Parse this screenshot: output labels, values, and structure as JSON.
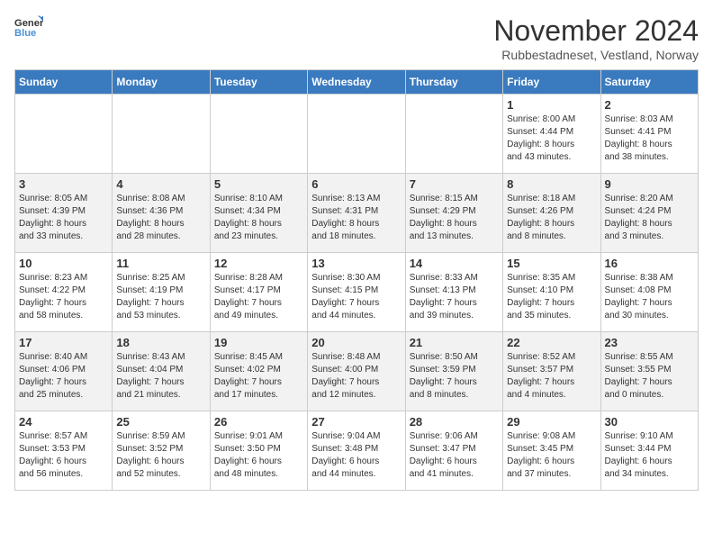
{
  "header": {
    "logo_general": "General",
    "logo_blue": "Blue",
    "month_title": "November 2024",
    "location": "Rubbestadneset, Vestland, Norway"
  },
  "weekdays": [
    "Sunday",
    "Monday",
    "Tuesday",
    "Wednesday",
    "Thursday",
    "Friday",
    "Saturday"
  ],
  "weeks": [
    [
      {
        "day": "",
        "info": ""
      },
      {
        "day": "",
        "info": ""
      },
      {
        "day": "",
        "info": ""
      },
      {
        "day": "",
        "info": ""
      },
      {
        "day": "",
        "info": ""
      },
      {
        "day": "1",
        "info": "Sunrise: 8:00 AM\nSunset: 4:44 PM\nDaylight: 8 hours\nand 43 minutes."
      },
      {
        "day": "2",
        "info": "Sunrise: 8:03 AM\nSunset: 4:41 PM\nDaylight: 8 hours\nand 38 minutes."
      }
    ],
    [
      {
        "day": "3",
        "info": "Sunrise: 8:05 AM\nSunset: 4:39 PM\nDaylight: 8 hours\nand 33 minutes."
      },
      {
        "day": "4",
        "info": "Sunrise: 8:08 AM\nSunset: 4:36 PM\nDaylight: 8 hours\nand 28 minutes."
      },
      {
        "day": "5",
        "info": "Sunrise: 8:10 AM\nSunset: 4:34 PM\nDaylight: 8 hours\nand 23 minutes."
      },
      {
        "day": "6",
        "info": "Sunrise: 8:13 AM\nSunset: 4:31 PM\nDaylight: 8 hours\nand 18 minutes."
      },
      {
        "day": "7",
        "info": "Sunrise: 8:15 AM\nSunset: 4:29 PM\nDaylight: 8 hours\nand 13 minutes."
      },
      {
        "day": "8",
        "info": "Sunrise: 8:18 AM\nSunset: 4:26 PM\nDaylight: 8 hours\nand 8 minutes."
      },
      {
        "day": "9",
        "info": "Sunrise: 8:20 AM\nSunset: 4:24 PM\nDaylight: 8 hours\nand 3 minutes."
      }
    ],
    [
      {
        "day": "10",
        "info": "Sunrise: 8:23 AM\nSunset: 4:22 PM\nDaylight: 7 hours\nand 58 minutes."
      },
      {
        "day": "11",
        "info": "Sunrise: 8:25 AM\nSunset: 4:19 PM\nDaylight: 7 hours\nand 53 minutes."
      },
      {
        "day": "12",
        "info": "Sunrise: 8:28 AM\nSunset: 4:17 PM\nDaylight: 7 hours\nand 49 minutes."
      },
      {
        "day": "13",
        "info": "Sunrise: 8:30 AM\nSunset: 4:15 PM\nDaylight: 7 hours\nand 44 minutes."
      },
      {
        "day": "14",
        "info": "Sunrise: 8:33 AM\nSunset: 4:13 PM\nDaylight: 7 hours\nand 39 minutes."
      },
      {
        "day": "15",
        "info": "Sunrise: 8:35 AM\nSunset: 4:10 PM\nDaylight: 7 hours\nand 35 minutes."
      },
      {
        "day": "16",
        "info": "Sunrise: 8:38 AM\nSunset: 4:08 PM\nDaylight: 7 hours\nand 30 minutes."
      }
    ],
    [
      {
        "day": "17",
        "info": "Sunrise: 8:40 AM\nSunset: 4:06 PM\nDaylight: 7 hours\nand 25 minutes."
      },
      {
        "day": "18",
        "info": "Sunrise: 8:43 AM\nSunset: 4:04 PM\nDaylight: 7 hours\nand 21 minutes."
      },
      {
        "day": "19",
        "info": "Sunrise: 8:45 AM\nSunset: 4:02 PM\nDaylight: 7 hours\nand 17 minutes."
      },
      {
        "day": "20",
        "info": "Sunrise: 8:48 AM\nSunset: 4:00 PM\nDaylight: 7 hours\nand 12 minutes."
      },
      {
        "day": "21",
        "info": "Sunrise: 8:50 AM\nSunset: 3:59 PM\nDaylight: 7 hours\nand 8 minutes."
      },
      {
        "day": "22",
        "info": "Sunrise: 8:52 AM\nSunset: 3:57 PM\nDaylight: 7 hours\nand 4 minutes."
      },
      {
        "day": "23",
        "info": "Sunrise: 8:55 AM\nSunset: 3:55 PM\nDaylight: 7 hours\nand 0 minutes."
      }
    ],
    [
      {
        "day": "24",
        "info": "Sunrise: 8:57 AM\nSunset: 3:53 PM\nDaylight: 6 hours\nand 56 minutes."
      },
      {
        "day": "25",
        "info": "Sunrise: 8:59 AM\nSunset: 3:52 PM\nDaylight: 6 hours\nand 52 minutes."
      },
      {
        "day": "26",
        "info": "Sunrise: 9:01 AM\nSunset: 3:50 PM\nDaylight: 6 hours\nand 48 minutes."
      },
      {
        "day": "27",
        "info": "Sunrise: 9:04 AM\nSunset: 3:48 PM\nDaylight: 6 hours\nand 44 minutes."
      },
      {
        "day": "28",
        "info": "Sunrise: 9:06 AM\nSunset: 3:47 PM\nDaylight: 6 hours\nand 41 minutes."
      },
      {
        "day": "29",
        "info": "Sunrise: 9:08 AM\nSunset: 3:45 PM\nDaylight: 6 hours\nand 37 minutes."
      },
      {
        "day": "30",
        "info": "Sunrise: 9:10 AM\nSunset: 3:44 PM\nDaylight: 6 hours\nand 34 minutes."
      }
    ]
  ]
}
